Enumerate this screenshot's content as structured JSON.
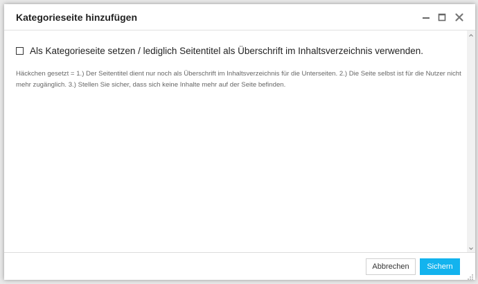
{
  "dialog": {
    "title": "Kategorieseite hinzufügen",
    "window_controls": {
      "minimize_icon": "minimize-icon",
      "maximize_icon": "maximize-icon",
      "close_icon": "close-icon"
    }
  },
  "form": {
    "category_checkbox": {
      "checked": false,
      "label": "Als Kategorieseite setzen / lediglich Seitentitel als Überschrift im Inhaltsverzeichnis verwenden."
    },
    "hint_text": "Häckchen gesetzt = 1.) Der Seitentitel dient nur noch als Überschrift im Inhaltsverzeichnis für die Unterseiten. 2.) Die Seite selbst ist für die Nutzer nicht mehr zugänglich. 3.) Stellen Sie sicher, dass sich keine Inhalte mehr auf der Seite befinden."
  },
  "footer": {
    "cancel_label": "Abbrechen",
    "save_label": "Sichern"
  },
  "colors": {
    "accent": "#13b3ee",
    "title_text": "#222222",
    "hint_text": "#666666"
  }
}
